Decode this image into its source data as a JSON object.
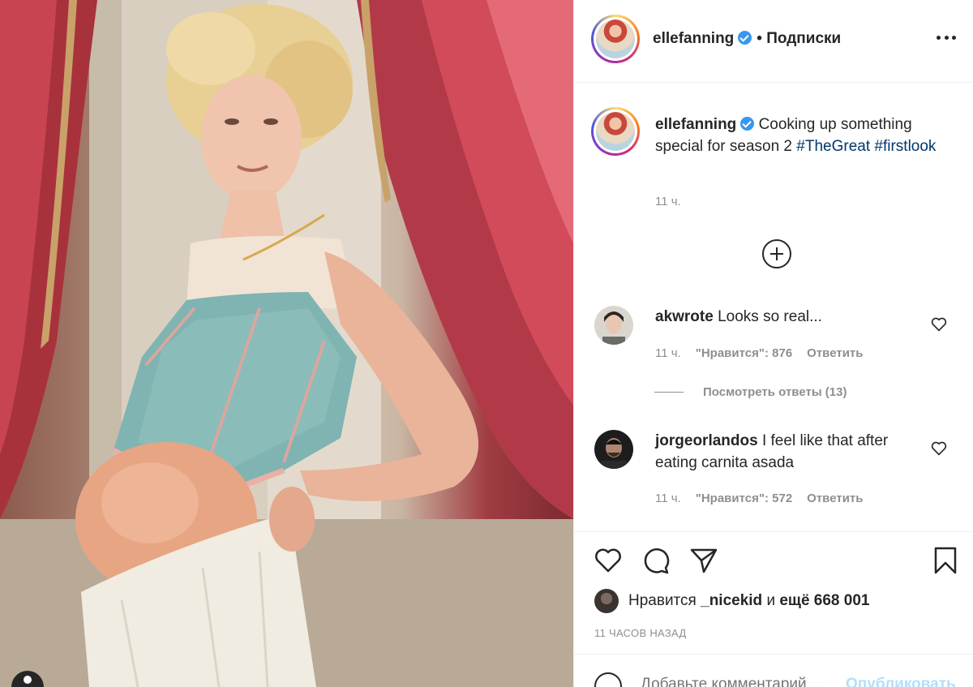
{
  "post": {
    "username": "ellefanning",
    "follow_status": "• Подписки",
    "caption": {
      "text": "Cooking up something special for season 2",
      "hashtags": [
        "#TheGreat",
        "#firstlook"
      ]
    },
    "caption_time": "11 ч."
  },
  "comments": [
    {
      "username": "akwrote",
      "text": "Looks so real...",
      "time": "11 ч.",
      "likes": "\"Нравится\": 876",
      "reply": "Ответить",
      "view_replies": "Посмотреть ответы (13)"
    },
    {
      "username": "jorgeorlandos",
      "text": "I feel like that after eating carnita asada",
      "time": "11 ч.",
      "likes": "\"Нравится\": 572",
      "reply": "Ответить"
    }
  ],
  "likes": {
    "prefix": "Нравится",
    "user": "_nicekid",
    "conj": "и",
    "count": "ещё 668 001"
  },
  "posted_ago": "11 ЧАСОВ НАЗАД",
  "add_comment": {
    "placeholder": "Добавьте комментарий...",
    "post_label": "Опубликовать"
  },
  "colors": {
    "hashtag": "#00376b",
    "verified": "#3897f0",
    "secondary": "#8e8e8e",
    "post_disabled": "#b2dffc"
  },
  "icons": [
    "more-icon",
    "verified-badge-icon",
    "plus-circle-icon",
    "heart-icon",
    "comment-icon",
    "share-icon",
    "bookmark-icon",
    "emoji-icon",
    "user-tag-icon"
  ]
}
